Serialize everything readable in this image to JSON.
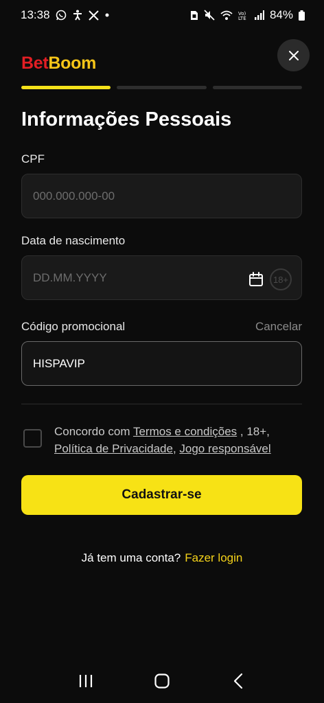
{
  "status_bar": {
    "time": "13:38",
    "battery": "84%",
    "left_icons": [
      "whatsapp-icon",
      "accessibility-icon",
      "x-icon",
      "dot-icon"
    ],
    "right_icons": [
      "sim-icon",
      "mute-icon",
      "wifi-icon",
      "volte-icon",
      "signal-icon",
      "battery-icon"
    ]
  },
  "header": {
    "logo_part1": "Bet",
    "logo_part2": "Boom",
    "close_icon": "close-icon"
  },
  "progress": {
    "steps": 3,
    "active_step": 1
  },
  "page": {
    "title": "Informações Pessoais"
  },
  "form": {
    "cpf": {
      "label": "CPF",
      "placeholder": "000.000.000-00"
    },
    "birthdate": {
      "label": "Data de nascimento",
      "placeholder": "DD.MM.YYYY",
      "icons": [
        "calendar-icon",
        "age-18-icon"
      ],
      "badge": "18+"
    },
    "promo": {
      "label": "Código promocional",
      "cancel": "Cancelar",
      "value": "HISPAVIP"
    }
  },
  "terms": {
    "prefix": "Concordo com ",
    "link1": "Termos e condições",
    "sep1": " , 18+",
    "comma": ",",
    "link2": "Política de Privacidade",
    "sep2": ", ",
    "link3": "Jogo responsável",
    "checked": false
  },
  "cta": {
    "label": "Cadastrar-se"
  },
  "login": {
    "question": "Já tem uma conta?",
    "link": "Fazer login"
  },
  "nav": {
    "icons": [
      "recent-apps-icon",
      "home-icon",
      "back-icon"
    ]
  },
  "colors": {
    "accent_yellow": "#f7e215",
    "logo_red": "#e31e24",
    "logo_yellow": "#f5c518",
    "link_yellow": "#f5d31a"
  }
}
